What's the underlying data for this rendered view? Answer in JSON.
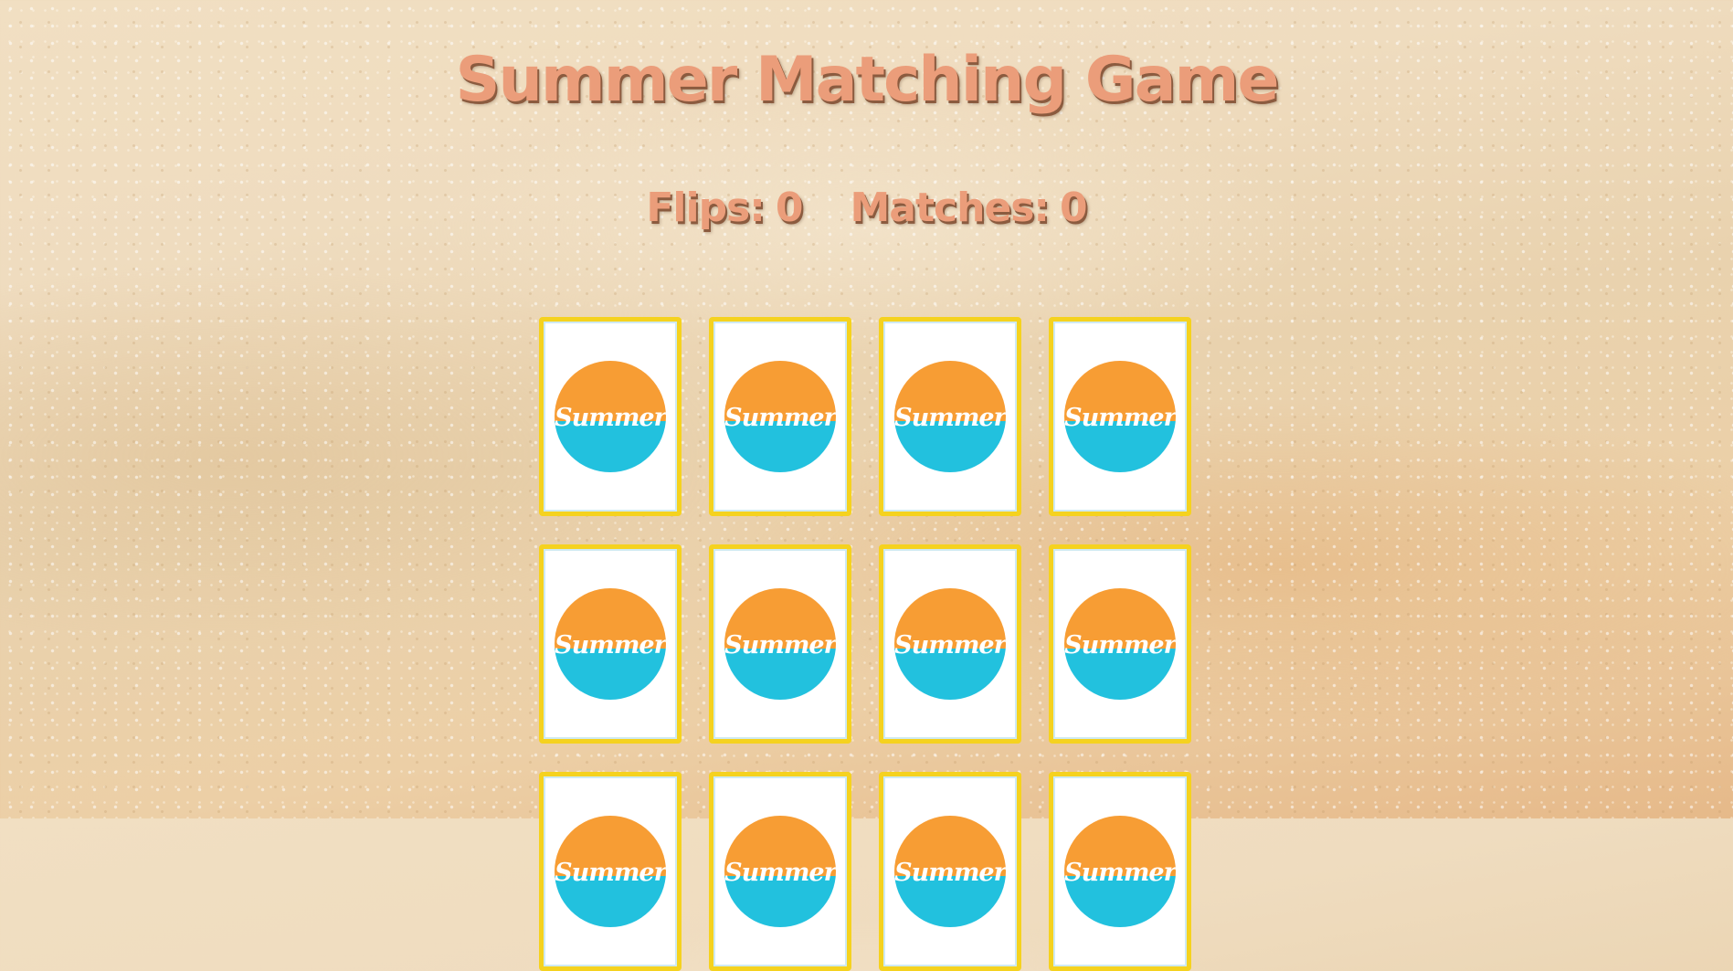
{
  "game": {
    "title": "Summer Matching Game"
  },
  "stats": {
    "flips_label": "Flips:",
    "flips_value": "0",
    "matches_label": "Matches:",
    "matches_value": "0"
  },
  "cards": [
    {
      "back_text": "Summer"
    },
    {
      "back_text": "Summer"
    },
    {
      "back_text": "Summer"
    },
    {
      "back_text": "Summer"
    },
    {
      "back_text": "Summer"
    },
    {
      "back_text": "Summer"
    },
    {
      "back_text": "Summer"
    },
    {
      "back_text": "Summer"
    },
    {
      "back_text": "Summer"
    },
    {
      "back_text": "Summer"
    },
    {
      "back_text": "Summer"
    },
    {
      "back_text": "Summer"
    }
  ],
  "colors": {
    "title": "#eb9d7a",
    "card_border": "#f5d21f",
    "sun_orange": "#f79d34",
    "sea_blue": "#22c1de"
  }
}
